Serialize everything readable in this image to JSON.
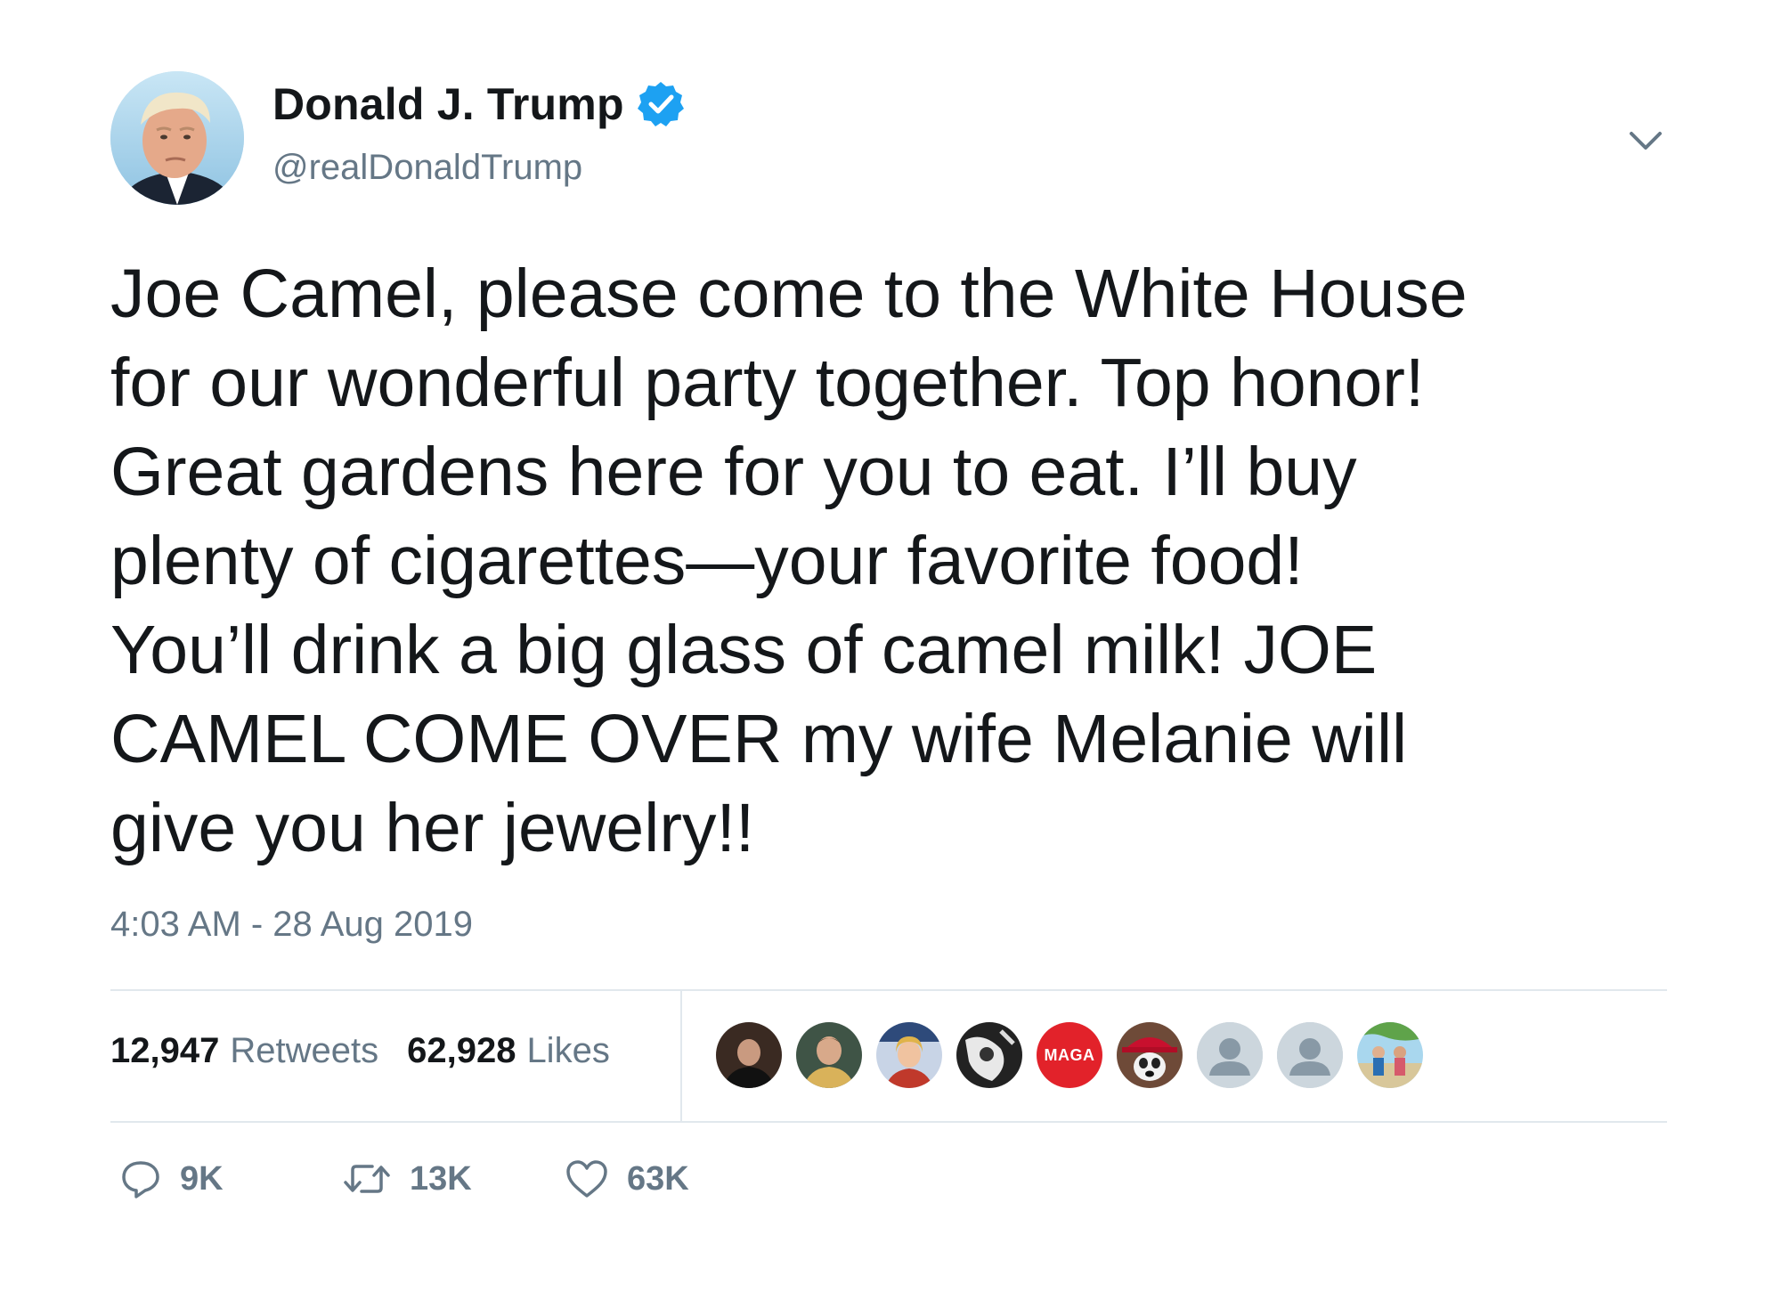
{
  "author": {
    "name": "Donald J. Trump",
    "handle": "@realDonaldTrump",
    "verified": true,
    "verified_color": "#1da1f2",
    "avatar_icon": "profile-photo"
  },
  "tweet": {
    "text": "Joe Camel, please come to the White House\nfor our wonderful party together. Top honor!\nGreat gardens here for you to eat. I’ll buy\nplenty of cigarettes—your favorite food!\nYou’ll drink a big glass of camel milk! JOE\nCAMEL COME OVER my wife Melanie will\ngive you her jewelry!!",
    "timestamp": "4:03 AM - 28 Aug 2019"
  },
  "stats": {
    "retweets_count": "12,947",
    "retweets_label": "Retweets",
    "likes_count": "62,928",
    "likes_label": "Likes"
  },
  "likers": [
    {
      "type": "photo",
      "icon": "liker-avatar-1"
    },
    {
      "type": "photo",
      "icon": "liker-avatar-2"
    },
    {
      "type": "photo",
      "icon": "liker-avatar-3"
    },
    {
      "type": "photo",
      "icon": "liker-avatar-4"
    },
    {
      "type": "badge",
      "label": "MAGA"
    },
    {
      "type": "photo",
      "icon": "liker-avatar-6"
    },
    {
      "type": "default",
      "icon": "default-user-icon"
    },
    {
      "type": "default",
      "icon": "default-user-icon"
    },
    {
      "type": "photo",
      "icon": "liker-avatar-9"
    }
  ],
  "actions": {
    "reply_count": "9K",
    "retweet_count": "13K",
    "like_count": "63K"
  },
  "colors": {
    "text": "#14171a",
    "secondary": "#657786",
    "divider": "#e1e8ed",
    "maga_red": "#e2222a"
  }
}
